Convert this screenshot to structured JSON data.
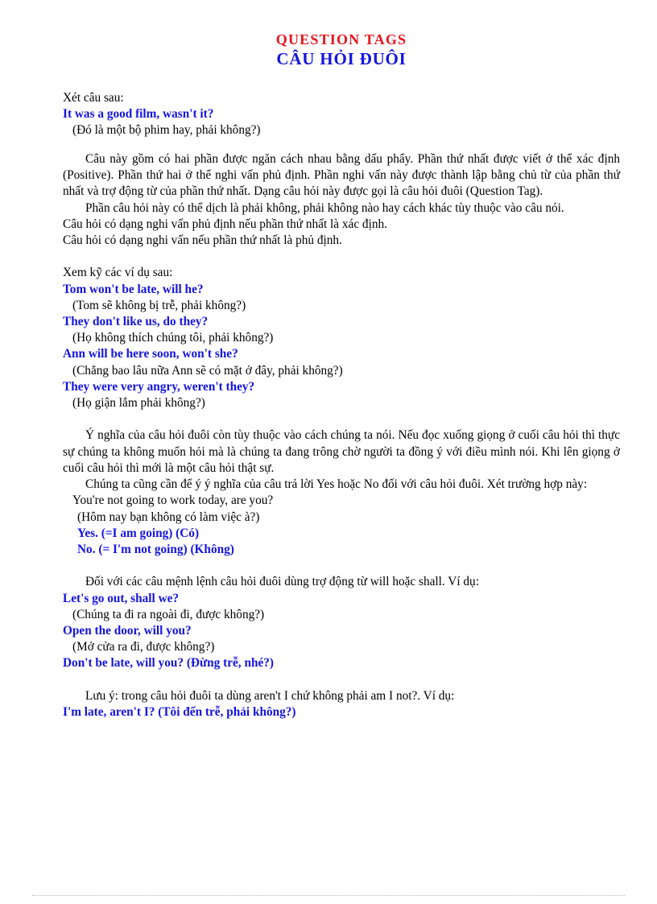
{
  "document": {
    "title_en": "QUESTION  TAGS",
    "title_vi": "CÂU HỎI ĐUÔI",
    "title_en_color": "#e8131a",
    "title_vi_color": "#1414e0",
    "example_color": "#1414e0"
  },
  "intro": {
    "lead": "Xét câu sau:",
    "example_en": "It was a good film, wasn't it?",
    "example_vi": "(Đó là một bộ phim hay, phải không?)"
  },
  "explanation": {
    "paragraph_1": "Câu này gồm có hai phần được ngăn cách nhau bằng dấu phẩy. Phần thứ nhất được viết ở thể xác định (Positive). Phần thứ hai ở thể nghi vấn phủ định. Phần nghi vấn này được thành lập bằng chủ từ của phần thứ nhất và trợ động từ của phần thứ nhất. Dạng câu hỏi này được gọi là câu hỏi đuôi (Question Tag).",
    "paragraph_2": "Phần câu hỏi này có thể dịch là phải không, phải không nào hay cách khác tùy thuộc vào câu nói.",
    "paragraph_3": "Câu hỏi có dạng nghi vấn phủ định nếu phần thứ nhất là xác định.",
    "paragraph_4": "Câu hỏi có dạng nghi vấn nếu phần thứ nhất là phủ định."
  },
  "examples_section": {
    "lead": "Xem kỹ các ví dụ sau:",
    "items": [
      {
        "en": "Tom won't be late, will he?",
        "vi": "(Tom sẽ không bị trễ, phải không?)"
      },
      {
        "en": "They don't like us, do they?",
        "vi": "(Họ không thích chúng tôi, phải không?)"
      },
      {
        "en": "Ann will be here soon, won't she?",
        "vi": "(Chẳng bao lâu nữa Ann sẽ có mặt ở đây, phải không?)"
      },
      {
        "en": "They were very angry, weren't they?",
        "vi": "(Họ giận lắm phải không?)"
      }
    ]
  },
  "intonation": {
    "paragraph_1": "Ý nghĩa của câu hỏi đuôi còn tùy thuộc vào cách chúng ta nói. Nếu đọc xuống giọng ở cuối câu hỏi thì thực sự chúng ta không muốn hỏi mà là chúng ta đang trông chờ người ta đồng ý với điều mình nói. Khi lên giọng ở cuối câu hỏi thì mới là một câu hỏi thật sự.",
    "paragraph_2": "Chúng ta cũng cần để ý ý nghĩa của câu trả lời Yes hoặc No đối với câu hỏi đuôi. Xét trường hợp này:",
    "question_en": "You're not going to work today, are you?",
    "question_vi": "(Hôm nay bạn không có làm việc à?)",
    "answer_yes": "Yes. (=I am going) (Có)",
    "answer_no": "No. (= I'm not going) (Không)"
  },
  "imperatives": {
    "lead": "Đối với các câu mệnh lệnh câu hỏi đuôi dùng trợ động từ will hoặc shall. Ví dụ:",
    "items": [
      {
        "en": "Let's go out, shall we?",
        "vi": "(Chúng ta đi ra ngoài đi, được không?)"
      },
      {
        "en": "Open the door, will you?",
        "vi": "(Mở cửa ra đi, được không?)"
      }
    ],
    "combined_example": "Don't be late, will you? (Đừng trễ, nhé?)"
  },
  "note": {
    "lead": "Lưu ý: trong câu hỏi đuôi ta dùng aren't I chứ không phải am I not?. Ví dụ:",
    "example": "I'm late, aren't I? (Tôi đến trễ, phải không?)"
  }
}
